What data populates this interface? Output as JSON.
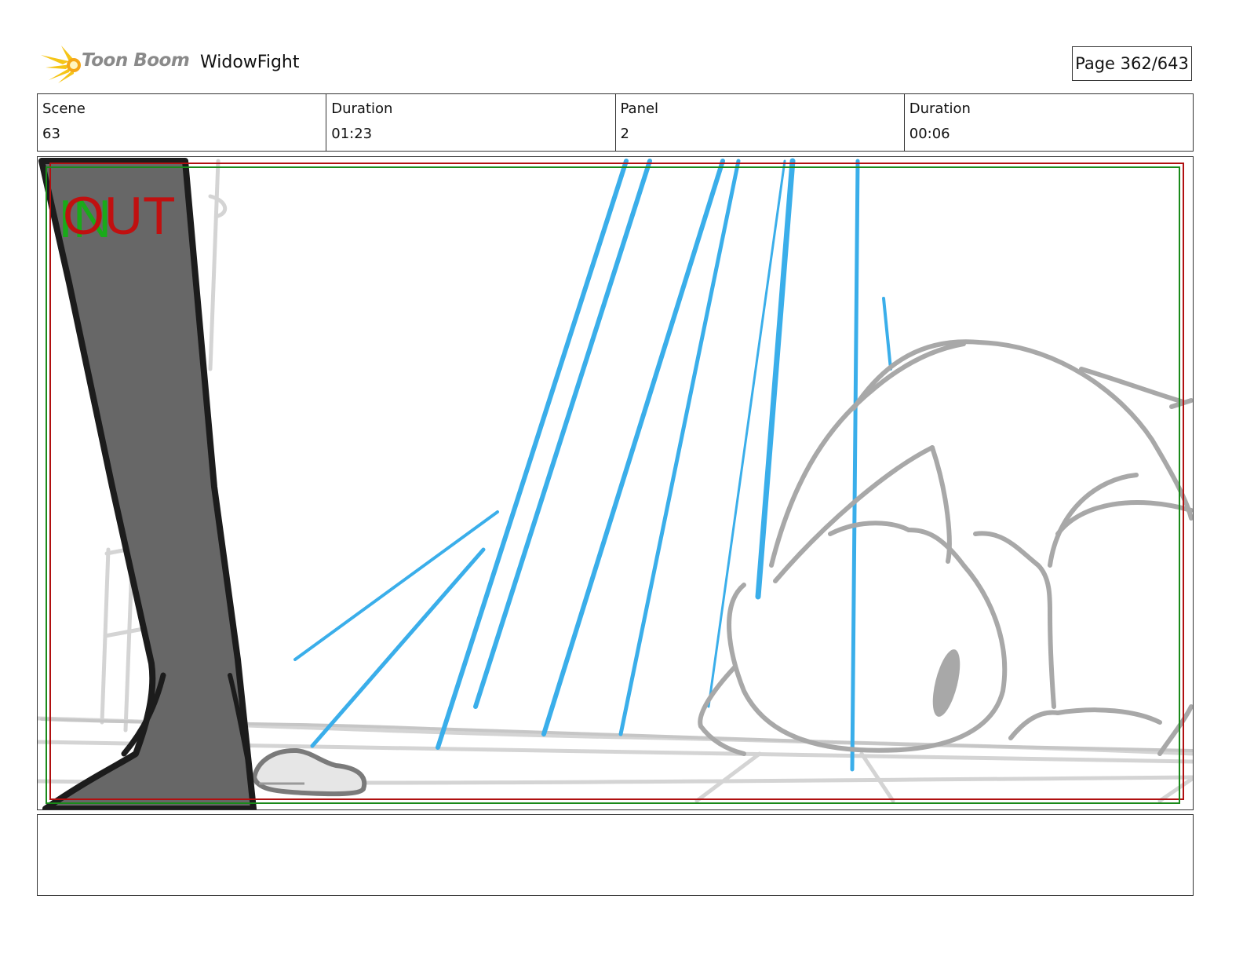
{
  "header": {
    "logo_text": "Toon Boom",
    "project_title": "WidowFight",
    "page_label": "Page 362/643"
  },
  "info": {
    "scene_label": "Scene",
    "scene_value": "63",
    "scene_duration_label": "Duration",
    "scene_duration_value": "01:23",
    "panel_label": "Panel",
    "panel_value": "2",
    "panel_duration_label": "Duration",
    "panel_duration_value": "00:06"
  },
  "panel": {
    "out_label": "OUT",
    "in_label": "IN"
  },
  "colors": {
    "safe_frame_red": "#b01010",
    "safe_frame_green": "#1a8a1a",
    "speed_lines": "#3aaeea",
    "sketch_grey": "#a8a8a8",
    "leg_fill": "#676767",
    "logo_yellow": "#f5c518"
  }
}
